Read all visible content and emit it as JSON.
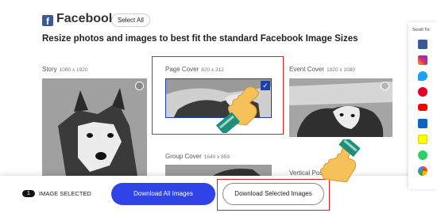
{
  "header": {
    "logo_letter": "f",
    "title": "Facebook",
    "select_all_label": "Select All"
  },
  "headline": "Resize photos and images to best fit the standard Facebook Image Sizes",
  "cards": {
    "story": {
      "title": "Story",
      "size": "1080 x 1920"
    },
    "page_cover": {
      "title": "Page Cover",
      "size": "820 x 312",
      "selected": true
    },
    "event_cover": {
      "title": "Event Cover",
      "size": "1920 x 1080"
    },
    "group_cover": {
      "title": "Group Cover",
      "size": "1640 x 859"
    },
    "vertical_post": {
      "title": "Vertical Post"
    }
  },
  "bottom_bar": {
    "selected_count": "1",
    "selected_label": "IMAGE SELECTED",
    "download_all_label": "Download All Images",
    "download_selected_label": "Download Selected Images"
  },
  "sidebar": {
    "title": "Scroll To:",
    "icons": [
      "facebook-icon",
      "instagram-icon",
      "twitter-icon",
      "pinterest-icon",
      "youtube-icon",
      "linkedin-icon",
      "snapchat-icon",
      "whatsapp-icon",
      "google-icon"
    ]
  },
  "colors": {
    "accent_blue": "#2f43e6",
    "facebook_blue": "#3b5998",
    "highlight_red": "#e02020",
    "hand_skin": "#f6c05b",
    "cuff_teal": "#1f8f7a"
  }
}
